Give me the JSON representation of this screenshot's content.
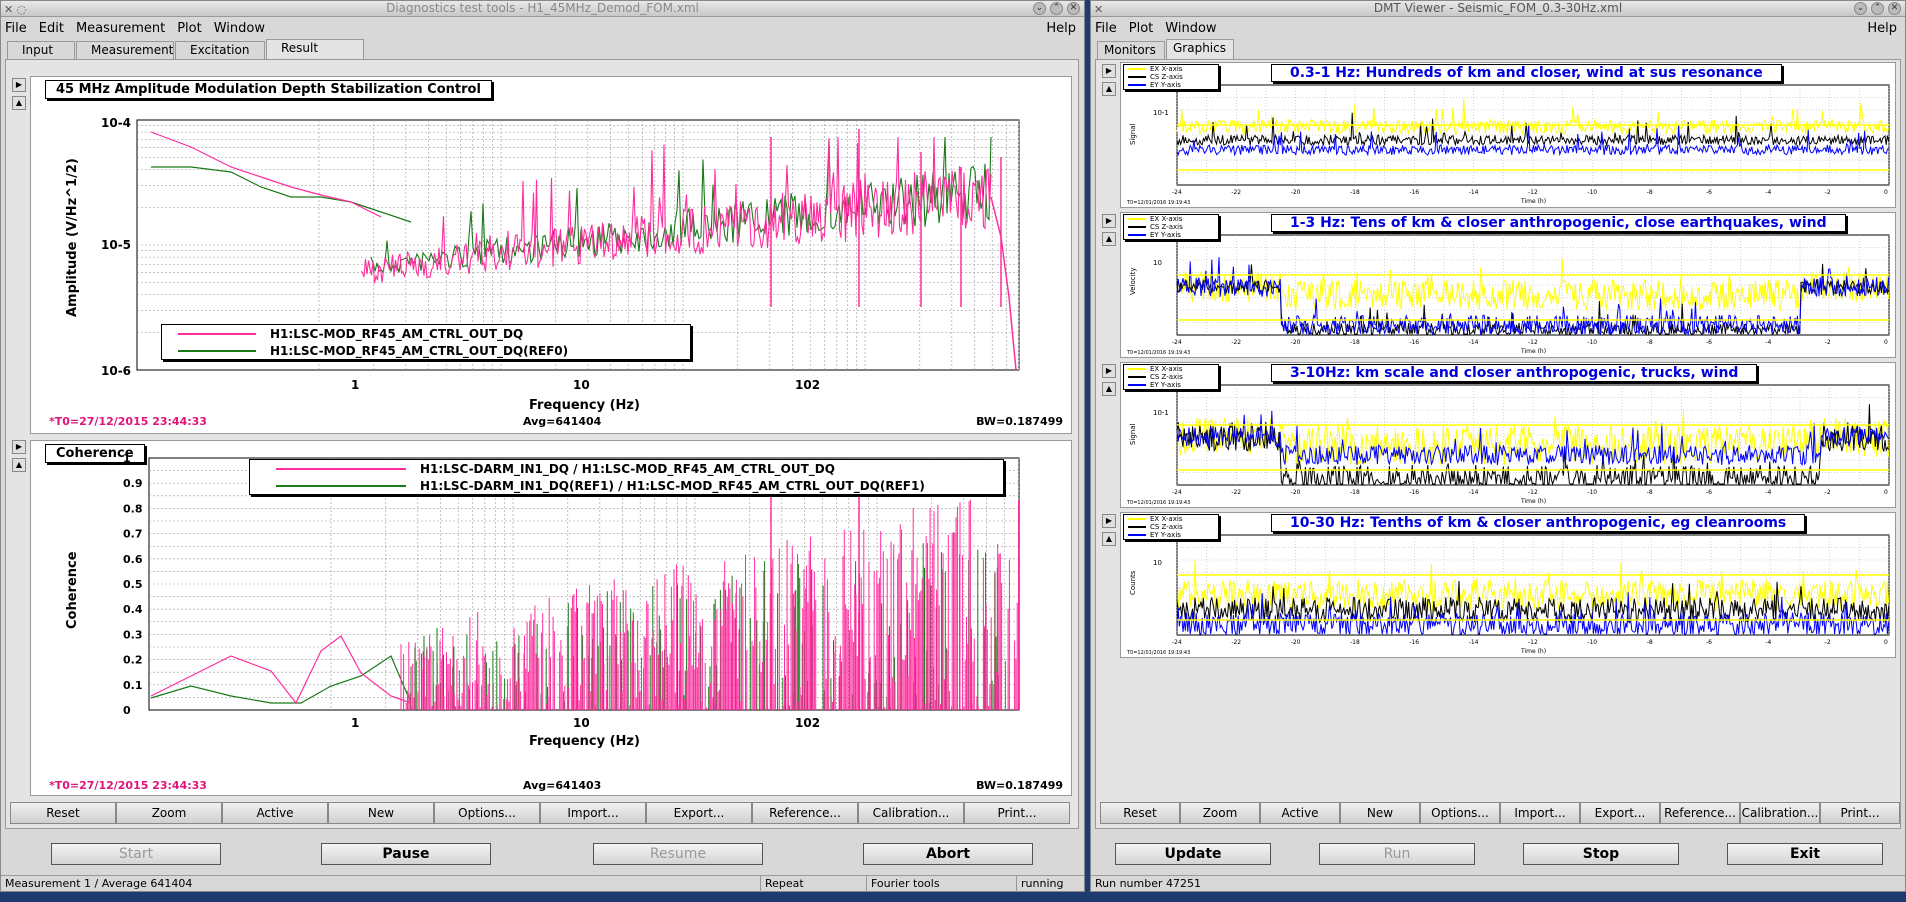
{
  "left": {
    "title": "Diagnostics test tools - H1_45MHz_Demod_FOM.xml",
    "menu": [
      "File",
      "Edit",
      "Measurement",
      "Plot",
      "Window"
    ],
    "help": "Help",
    "tabs": [
      "Input",
      "Measurement",
      "Excitation",
      "Result"
    ],
    "active_tab": "Result",
    "plot1": {
      "title": "45 MHz Amplitude Modulation Depth Stabilization Control",
      "ylabel": "Amplitude (V/Hz^1/2)",
      "xlabel": "Frequency (Hz)",
      "yticks": [
        "10-4",
        "10-5",
        "10-6"
      ],
      "xticks": [
        "1",
        "10",
        "102"
      ],
      "legend": [
        "H1:LSC-MOD_RF45_AM_CTRL_OUT_DQ",
        "H1:LSC-MOD_RF45_AM_CTRL_OUT_DQ(REF0)"
      ],
      "t0": "*T0=27/12/2015 23:44:33",
      "avg": "Avg=641404",
      "bw": "BW=0.187499"
    },
    "plot2": {
      "title": "Coherence",
      "ylabel": "Coherence",
      "xlabel": "Frequency (Hz)",
      "yticks": [
        "1",
        "0.9",
        "0.8",
        "0.7",
        "0.6",
        "0.5",
        "0.4",
        "0.3",
        "0.2",
        "0.1",
        "0"
      ],
      "xticks": [
        "1",
        "10",
        "102"
      ],
      "legend": [
        "H1:LSC-DARM_IN1_DQ / H1:LSC-MOD_RF45_AM_CTRL_OUT_DQ",
        "H1:LSC-DARM_IN1_DQ(REF1) / H1:LSC-MOD_RF45_AM_CTRL_OUT_DQ(REF1)"
      ],
      "t0": "*T0=27/12/2015 23:44:33",
      "avg": "Avg=641403",
      "bw": "BW=0.187499"
    },
    "toolbar": [
      "Reset",
      "Zoom",
      "Active",
      "New",
      "Options...",
      "Import...",
      "Export...",
      "Reference...",
      "Calibration...",
      "Print..."
    ],
    "controls": {
      "start": "Start",
      "pause": "Pause",
      "resume": "Resume",
      "abort": "Abort"
    },
    "status": [
      "Measurement 1 / Average 641404",
      "Repeat",
      "Fourier tools",
      "running"
    ],
    "colors": {
      "current": "#ff2d9e",
      "ref": "#1a7a1a"
    }
  },
  "right": {
    "title": "DMT Viewer - Seismic_FOM_0.3-30Hz.xml",
    "menu": [
      "File",
      "Plot",
      "Window"
    ],
    "help": "Help",
    "tabs": [
      "Monitors",
      "Graphics"
    ],
    "active_tab": "Graphics",
    "panels": [
      {
        "title": "0.3-1 Hz: Hundreds of km and closer, wind at sus resonance",
        "ylabel": "Signal",
        "ytick": "10-1"
      },
      {
        "title": "1-3 Hz: Tens of km & closer anthropogenic, close earthquakes, wind",
        "ylabel": "Velocity",
        "ytick": "10"
      },
      {
        "title": "3-10Hz: km scale and closer anthropogenic, trucks, wind",
        "ylabel": "Signal",
        "ytick": "10-1"
      },
      {
        "title": "10-30 Hz: Tenths of km & closer anthropogenic, eg cleanrooms",
        "ylabel": "Counts",
        "ytick": "10"
      }
    ],
    "legend": [
      "EX X-axis",
      "CS Z-axis",
      "EY Y-axis"
    ],
    "xlabel": "Time (h)",
    "xticks": [
      "-24",
      "-22",
      "-20",
      "-18",
      "-16",
      "-14",
      "-12",
      "-10",
      "-8",
      "-6",
      "-4",
      "-2",
      "0"
    ],
    "t0": "T0=12/01/2016 19:19:43",
    "toolbar": [
      "Reset",
      "Zoom",
      "Active",
      "New",
      "Options...",
      "Import...",
      "Export...",
      "Reference...",
      "Calibration...",
      "Print..."
    ],
    "controls": {
      "update": "Update",
      "run": "Run",
      "stop": "Stop",
      "exit": "Exit"
    },
    "status": "Run number 47251",
    "colors": {
      "x": "#ffff00",
      "z": "#000000",
      "y": "#0000ff"
    }
  }
}
